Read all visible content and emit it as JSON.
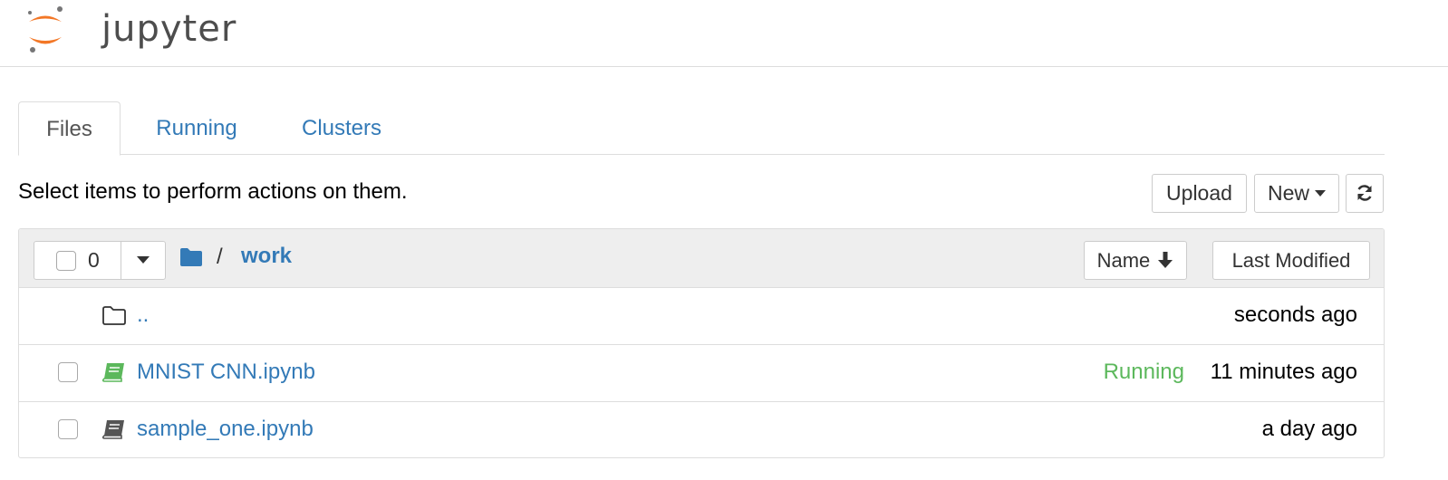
{
  "header": {
    "logo_text": "jupyter"
  },
  "tabs": [
    {
      "label": "Files"
    },
    {
      "label": "Running"
    },
    {
      "label": "Clusters"
    }
  ],
  "toolbar": {
    "instructions": "Select items to perform actions on them.",
    "upload_label": "Upload",
    "new_label": "New"
  },
  "list_header": {
    "selected_count": "0",
    "breadcrumb_separator": "/",
    "breadcrumb_folder": "work",
    "sort_name_label": "Name",
    "sort_modified_label": "Last Modified"
  },
  "files": [
    {
      "name": "..",
      "type": "folder",
      "status": "",
      "modified": "seconds ago"
    },
    {
      "name": "MNIST CNN.ipynb",
      "type": "notebook-running",
      "status": "Running",
      "modified": "11 minutes ago"
    },
    {
      "name": "sample_one.ipynb",
      "type": "notebook",
      "status": "",
      "modified": "a day ago"
    }
  ],
  "colors": {
    "link": "#337ab7",
    "running": "#5cb85c",
    "logo_orange": "#f37726",
    "logo_gray": "#767677"
  },
  "icons": {
    "refresh": "refresh-icon",
    "folder": "folder-icon",
    "notebook": "book-icon",
    "sort": "arrow-down-icon"
  }
}
